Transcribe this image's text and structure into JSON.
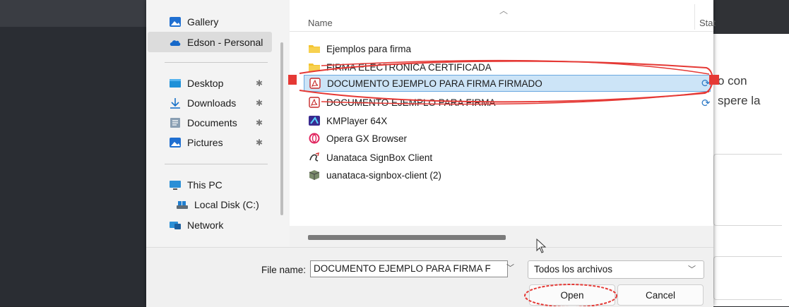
{
  "nav": {
    "gallery": "Gallery",
    "onedrive": "Edson - Personal",
    "desktop": "Desktop",
    "downloads": "Downloads",
    "documents": "Documents",
    "pictures": "Pictures",
    "this_pc": "This PC",
    "local_disk": "Local Disk (C:)",
    "network": "Network"
  },
  "columns": {
    "name": "Name",
    "status": "Stat"
  },
  "files": [
    {
      "name": "Ejemplos para firma",
      "icon": "folder-icon"
    },
    {
      "name": "FIRMA ELECTRONICA CERTIFICADA",
      "icon": "folder-icon"
    },
    {
      "name": "DOCUMENTO EJEMPLO PARA FIRMA FIRMADO",
      "icon": "pdf-icon"
    },
    {
      "name": "DOCUMENTO EJEMPLO PARA FIRMA",
      "icon": "pdf-icon"
    },
    {
      "name": "KMPlayer 64X",
      "icon": "kmplayer-icon"
    },
    {
      "name": "Opera GX Browser",
      "icon": "opera-gx-icon"
    },
    {
      "name": "Uanataca SignBox Client",
      "icon": "signbox-icon"
    },
    {
      "name": "uanataca-signbox-client (2)",
      "icon": "installer-icon"
    }
  ],
  "footer": {
    "file_name_label": "File name:",
    "file_name_value": "DOCUMENTO EJEMPLO PARA FIRMA F",
    "file_type": "Todos los archivos",
    "open": "Open",
    "cancel": "Cancel"
  },
  "background": {
    "line1": "o con",
    "line2": "spere la"
  },
  "colors": {
    "selection": "#cce4f7",
    "annotation": "#e53935",
    "folder": "#f4c430",
    "pdf": "#c62828",
    "sync": "#2b78c5"
  }
}
